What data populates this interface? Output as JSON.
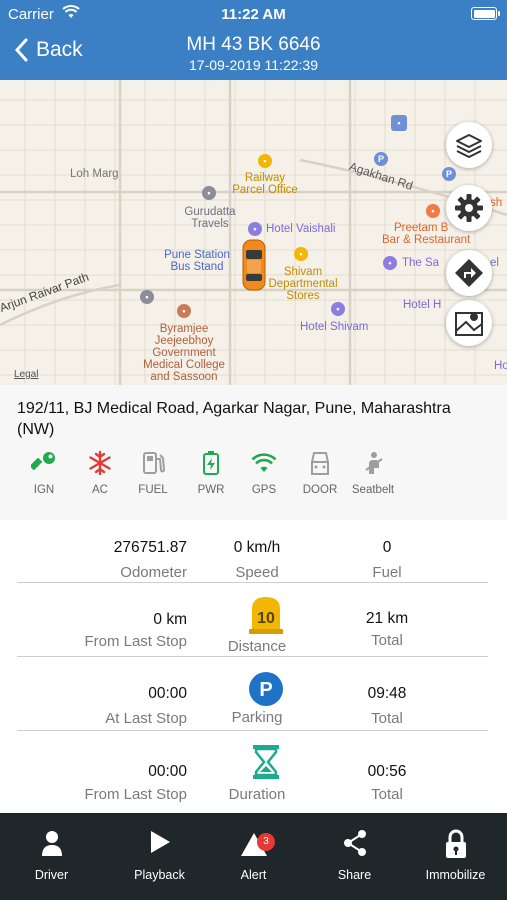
{
  "status_bar": {
    "carrier": "Carrier",
    "time": "11:22 AM"
  },
  "header": {
    "back_label": "Back",
    "title": "MH 43 BK 6646",
    "subtitle": "17-09-2019 11:22:39"
  },
  "map": {
    "labels": {
      "loh_marg": "Loh Marg",
      "agakhan_rd": "Agakhan Rd",
      "railway_parcel_1": "Railway",
      "railway_parcel_2": "Parcel Office",
      "gurudatta_1": "Gurudatta",
      "gurudatta_2": "Travels",
      "hotel_vaishali": "Hotel Vaishali",
      "preetam_1": "Preetam B",
      "preetam_2": "Bar & Restaurant",
      "the_sa": "The Sa",
      "pune_station_1": "Pune Station",
      "pune_station_2": "Bus Stand",
      "shivam_1": "Shivam",
      "shivam_2": "Departmental",
      "shivam_3": "Stores",
      "arjun_path": "Arjun Raivar Path",
      "byramjee_1": "Byramjee",
      "byramjee_2": "Jeejeebhoy",
      "byramjee_3": "Government",
      "byramjee_4": "Medical College",
      "byramjee_5": "and Sassoon",
      "hotel_shivam": "Hotel Shivam",
      "hotel_h": "Hotel H",
      "el": "el",
      "sh": "sh",
      "ho": "Ho",
      "legal": "Legal"
    },
    "buttons": [
      "layers-icon",
      "settings-icon",
      "directions-icon",
      "map-view-icon"
    ]
  },
  "address": {
    "text": "192/11, BJ Medical Road, Agarkar Nagar, Pune, Maharashtra (NW)",
    "status_items": [
      {
        "label": "IGN",
        "icon": "key-icon",
        "color": "#1faa4f"
      },
      {
        "label": "AC",
        "icon": "snowflake-icon",
        "color": "#e53935"
      },
      {
        "label": "FUEL",
        "icon": "fuel-icon",
        "color": "#9e9e9e"
      },
      {
        "label": "PWR",
        "icon": "battery-icon",
        "color": "#1faa4f"
      },
      {
        "label": "GPS",
        "icon": "wifi-icon",
        "color": "#1faa4f"
      },
      {
        "label": "DOOR",
        "icon": "door-icon",
        "color": "#9e9e9e"
      },
      {
        "label": "Seatbelt",
        "icon": "seatbelt-icon",
        "color": "#9e9e9e"
      }
    ]
  },
  "stats": {
    "row1": {
      "left_val": "276751.87",
      "left_lbl": "Odometer",
      "mid_val": "0 km/h",
      "mid_lbl": "Speed",
      "right_val": "0",
      "right_lbl": "Fuel"
    },
    "row2": {
      "left_val": "0 km",
      "left_lbl": "From Last Stop",
      "badge": "10",
      "mid_lbl": "Distance",
      "right_val": "21 km",
      "right_lbl": "Total"
    },
    "row3": {
      "left_val": "00:00",
      "left_lbl": "At Last Stop",
      "badge": "P",
      "mid_lbl": "Parking",
      "right_val": "09:48",
      "right_lbl": "Total"
    },
    "row4": {
      "left_val": "00:00",
      "left_lbl": "From Last Stop",
      "mid_lbl": "Duration",
      "right_val": "00:56",
      "right_lbl": "Total"
    }
  },
  "colors": {
    "header": "#3b7fc4",
    "tab_bar": "#1f272b",
    "distance_badge": "#f2b705",
    "parking": "#1e73c8",
    "duration": "#1faa8f"
  },
  "tabs": [
    {
      "label": "Driver",
      "icon": "person-icon"
    },
    {
      "label": "Playback",
      "icon": "play-icon"
    },
    {
      "label": "Alert",
      "icon": "alert-icon",
      "badge": "3"
    },
    {
      "label": "Share",
      "icon": "share-icon"
    },
    {
      "label": "Immobilize",
      "icon": "lock-icon"
    }
  ]
}
